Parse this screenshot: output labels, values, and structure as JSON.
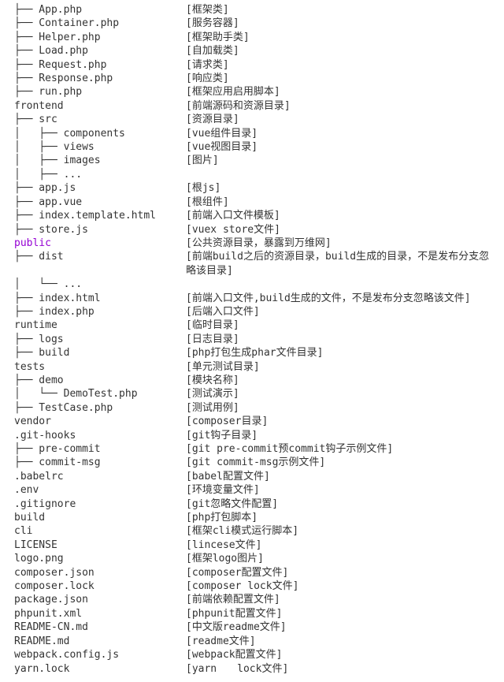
{
  "rows": [
    {
      "l": "├── App.php",
      "r": "[框架类]"
    },
    {
      "l": "├── Container.php",
      "r": "[服务容器]"
    },
    {
      "l": "├── Helper.php",
      "r": "[框架助手类]"
    },
    {
      "l": "├── Load.php",
      "r": "[自加载类]"
    },
    {
      "l": "├── Request.php",
      "r": "[请求类]"
    },
    {
      "l": "├── Response.php",
      "r": "[响应类]"
    },
    {
      "l": "├── run.php",
      "r": "[框架应用启用脚本]"
    },
    {
      "l": "frontend",
      "r": "[前端源码和资源目录]"
    },
    {
      "l": "├── src",
      "r": "[资源目录]"
    },
    {
      "l": "│   ├── components",
      "r": "[vue组件目录]"
    },
    {
      "l": "│   ├── views",
      "r": "[vue视图目录]"
    },
    {
      "l": "│   ├── images",
      "r": "[图片]"
    },
    {
      "l": "│   ├── ...",
      "r": ""
    },
    {
      "l": "├── app.js",
      "r": "[根js]"
    },
    {
      "l": "├── app.vue",
      "r": "[根组件]"
    },
    {
      "l": "├── index.template.html",
      "r": "[前端入口文件模板]"
    },
    {
      "l": "├── store.js",
      "r": "[vuex store文件]"
    },
    {
      "l": "public",
      "purple": true,
      "r": "[公共资源目录，暴露到万维网]"
    },
    {
      "l": "├── dist",
      "r": "[前端build之后的资源目录，build生成的目录，不是发布分支忽略该目录]"
    },
    {
      "l": "│   └── ...",
      "r": ""
    },
    {
      "l": "├── index.html",
      "r": "[前端入口文件,build生成的文件，不是发布分支忽略该文件]"
    },
    {
      "l": "├── index.php",
      "r": "[后端入口文件]"
    },
    {
      "l": "runtime",
      "r": "[临时目录]"
    },
    {
      "l": "├── logs",
      "r": "[日志目录]"
    },
    {
      "l": "├── build",
      "r": "[php打包生成phar文件目录]"
    },
    {
      "l": "tests",
      "r": "[单元测试目录]"
    },
    {
      "l": "├── demo",
      "r": "[模块名称]"
    },
    {
      "l": "│   └── DemoTest.php",
      "r": "[测试演示]"
    },
    {
      "l": "├── TestCase.php",
      "r": "[测试用例]"
    },
    {
      "l": "vendor",
      "r": "[composer目录]"
    },
    {
      "l": ".git-hooks",
      "r": "[git钩子目录]"
    },
    {
      "l": "├── pre-commit",
      "r": "[git pre-commit预commit钩子示例文件]"
    },
    {
      "l": "├── commit-msg",
      "r": "[git commit-msg示例文件]"
    },
    {
      "l": ".babelrc",
      "r": "[babel配置文件]"
    },
    {
      "l": ".env",
      "r": "[环境变量文件]"
    },
    {
      "l": ".gitignore",
      "r": "[git忽略文件配置]"
    },
    {
      "l": "build",
      "r": "[php打包脚本]"
    },
    {
      "l": "cli",
      "r": "[框架cli模式运行脚本]"
    },
    {
      "l": "LICENSE",
      "r": "[lincese文件]"
    },
    {
      "l": "logo.png",
      "r": "[框架logo图片]"
    },
    {
      "l": "composer.json",
      "r": "[composer配置文件]"
    },
    {
      "l": "composer.lock",
      "r": "[composer lock文件]"
    },
    {
      "l": "package.json",
      "r": "[前端依赖配置文件]"
    },
    {
      "l": "phpunit.xml",
      "r": "[phpunit配置文件]"
    },
    {
      "l": "README-CN.md",
      "r": "[中文版readme文件]"
    },
    {
      "l": "README.md",
      "r": "[readme文件]"
    },
    {
      "l": "webpack.config.js",
      "r": "[webpack配置文件]"
    },
    {
      "l": "yarn.lock",
      "r": "[yarn　　lock文件]"
    }
  ]
}
